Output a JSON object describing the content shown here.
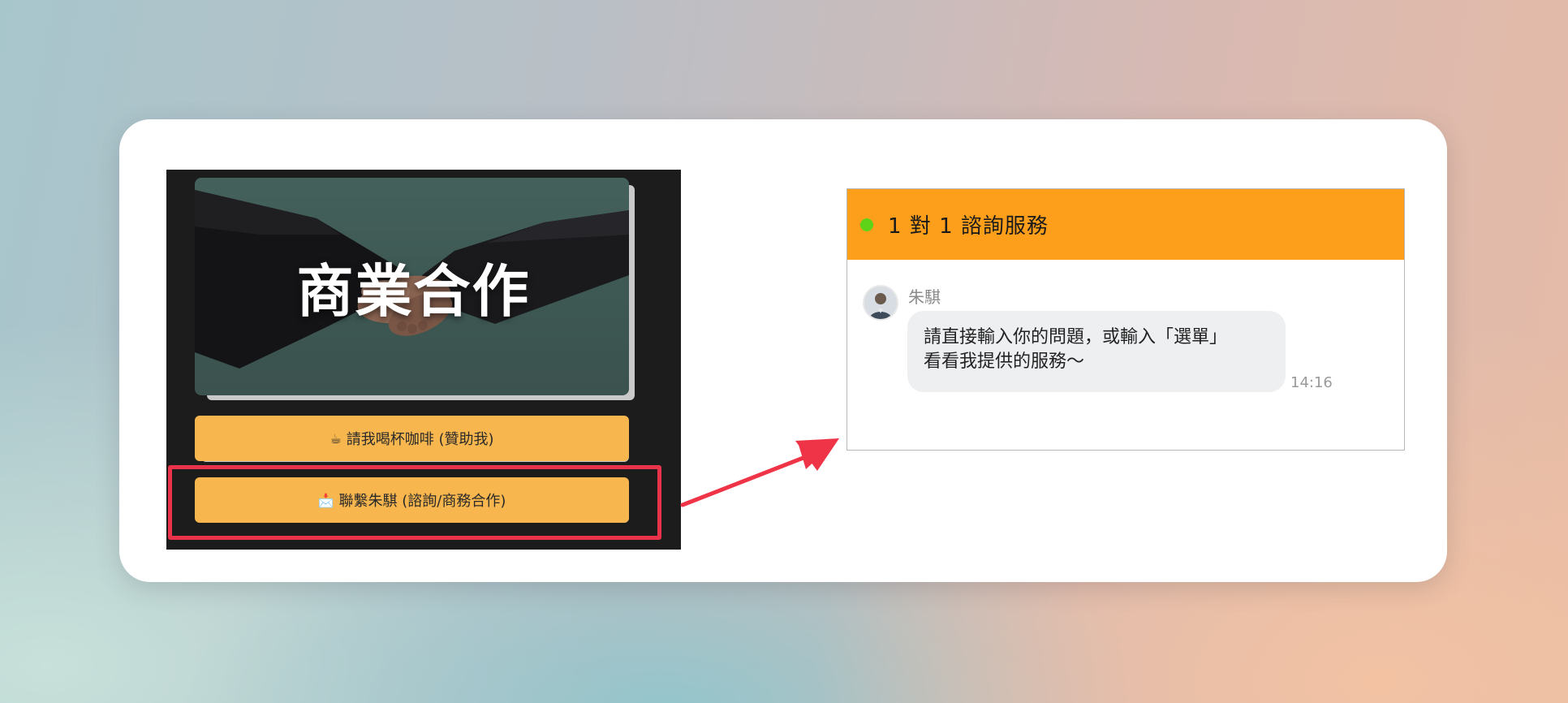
{
  "left_panel": {
    "hero_title": "商業合作",
    "buttons": [
      {
        "icon": "coffee-icon",
        "glyph": "☕",
        "label": "請我喝杯咖啡 (贊助我)"
      },
      {
        "icon": "envelope-icon",
        "glyph": "📩",
        "label": "聯繫朱騏 (諮詢/商務合作)"
      }
    ]
  },
  "chat": {
    "title": "1 對 1 諮詢服務",
    "status_color": "#5ed318",
    "header_color": "#fd9f1a",
    "message": {
      "sender": "朱騏",
      "lines": [
        "請直接輸入你的問題，或輸入「選單」",
        "看看我提供的服務～"
      ],
      "time": "14:16"
    }
  },
  "colors": {
    "highlight_border": "#e8334a",
    "arrow": "#ef3448",
    "button_bg": "#f8b74e"
  }
}
